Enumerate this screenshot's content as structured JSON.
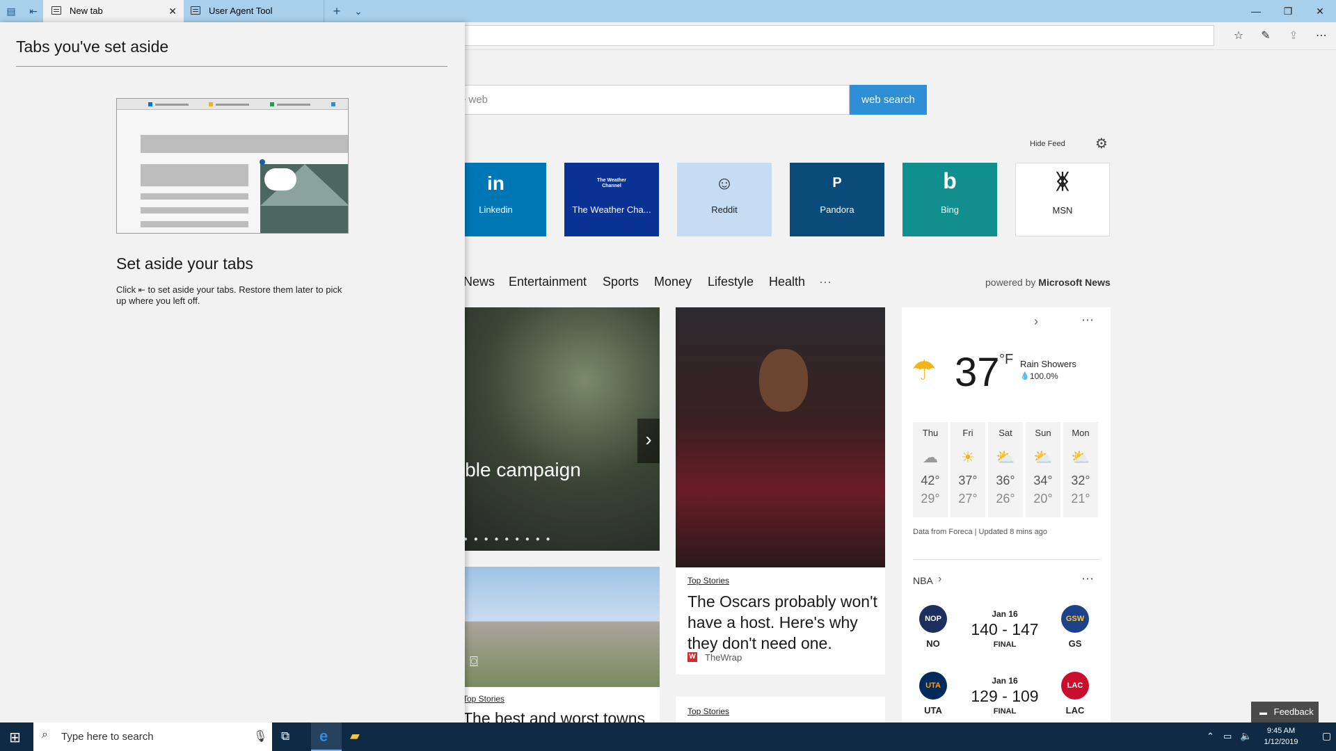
{
  "browser": {
    "tabs": [
      {
        "label": "New tab"
      },
      {
        "label": "User Agent Tool"
      }
    ],
    "toolbar_icons": [
      "favorites-icon",
      "pen-icon",
      "share-icon",
      "more-icon"
    ]
  },
  "search": {
    "placeholder": "e web",
    "button": "web search"
  },
  "feed": {
    "hide_label": "Hide Feed"
  },
  "tiles": [
    {
      "glyph": "in",
      "name": "Linkedin",
      "color": "#0077b5"
    },
    {
      "glyph": "The Weather Channel",
      "name": "The Weather Cha...",
      "color": "#0a3194"
    },
    {
      "glyph": "☺",
      "name": "Reddit",
      "color": "#c5dcf3"
    },
    {
      "glyph": "P",
      "name": "Pandora",
      "color": "#0a4b7a"
    },
    {
      "glyph": "b",
      "name": "Bing",
      "color": "#118f8f"
    },
    {
      "glyph": "ᛤ",
      "name": "MSN",
      "color": "#ffffff"
    }
  ],
  "news_nav": [
    "News",
    "Entertainment",
    "Sports",
    "Money",
    "Lifestyle",
    "Health",
    "···"
  ],
  "powered_by": {
    "prefix": "powered by",
    "brand": "Microsoft News"
  },
  "hero": {
    "caption": "ible campaign"
  },
  "cards": [
    {
      "tag": "Top Stories",
      "title": "The Oscars probably won't have a host. Here's why they don't need one.",
      "source": "TheWrap"
    },
    {
      "tag": "Top Stories",
      "title": "The best and worst towns"
    },
    {
      "tag": "Top Stories"
    }
  ],
  "weather": {
    "temp": "37",
    "unit": "°F",
    "condition": "Rain Showers",
    "precip": "100.0%",
    "forecast": [
      {
        "day": "Thu",
        "hi": "42°",
        "lo": "29°",
        "icon": "rain-cloud-icon"
      },
      {
        "day": "Fri",
        "hi": "37°",
        "lo": "27°",
        "icon": "sun-icon"
      },
      {
        "day": "Sat",
        "hi": "36°",
        "lo": "26°",
        "icon": "partly-cloudy-icon"
      },
      {
        "day": "Sun",
        "hi": "34°",
        "lo": "20°",
        "icon": "partly-cloudy-icon"
      },
      {
        "day": "Mon",
        "hi": "32°",
        "lo": "21°",
        "icon": "partly-cloudy-icon"
      }
    ],
    "footer": "Data from Foreca | Updated 8 mins ago"
  },
  "nba": {
    "label": "NBA",
    "games": [
      {
        "date": "Jan 16",
        "score": "140 - 147",
        "status": "FINAL",
        "home": "NO",
        "away": "GS"
      },
      {
        "date": "Jan 16",
        "score": "129 - 109",
        "status": "FINAL",
        "home": "UTA",
        "away": "LAC"
      }
    ]
  },
  "aside": {
    "title": "Tabs you've set aside",
    "subtitle": "Set aside your tabs",
    "desc_prefix": "Click",
    "desc_suffix": "to set aside your tabs. Restore them later to pick up where you left off."
  },
  "taskbar": {
    "search_placeholder": "Type here to search",
    "time": "9:45 AM",
    "date": "1/12/2019"
  },
  "feedback": {
    "label": "Feedback"
  }
}
